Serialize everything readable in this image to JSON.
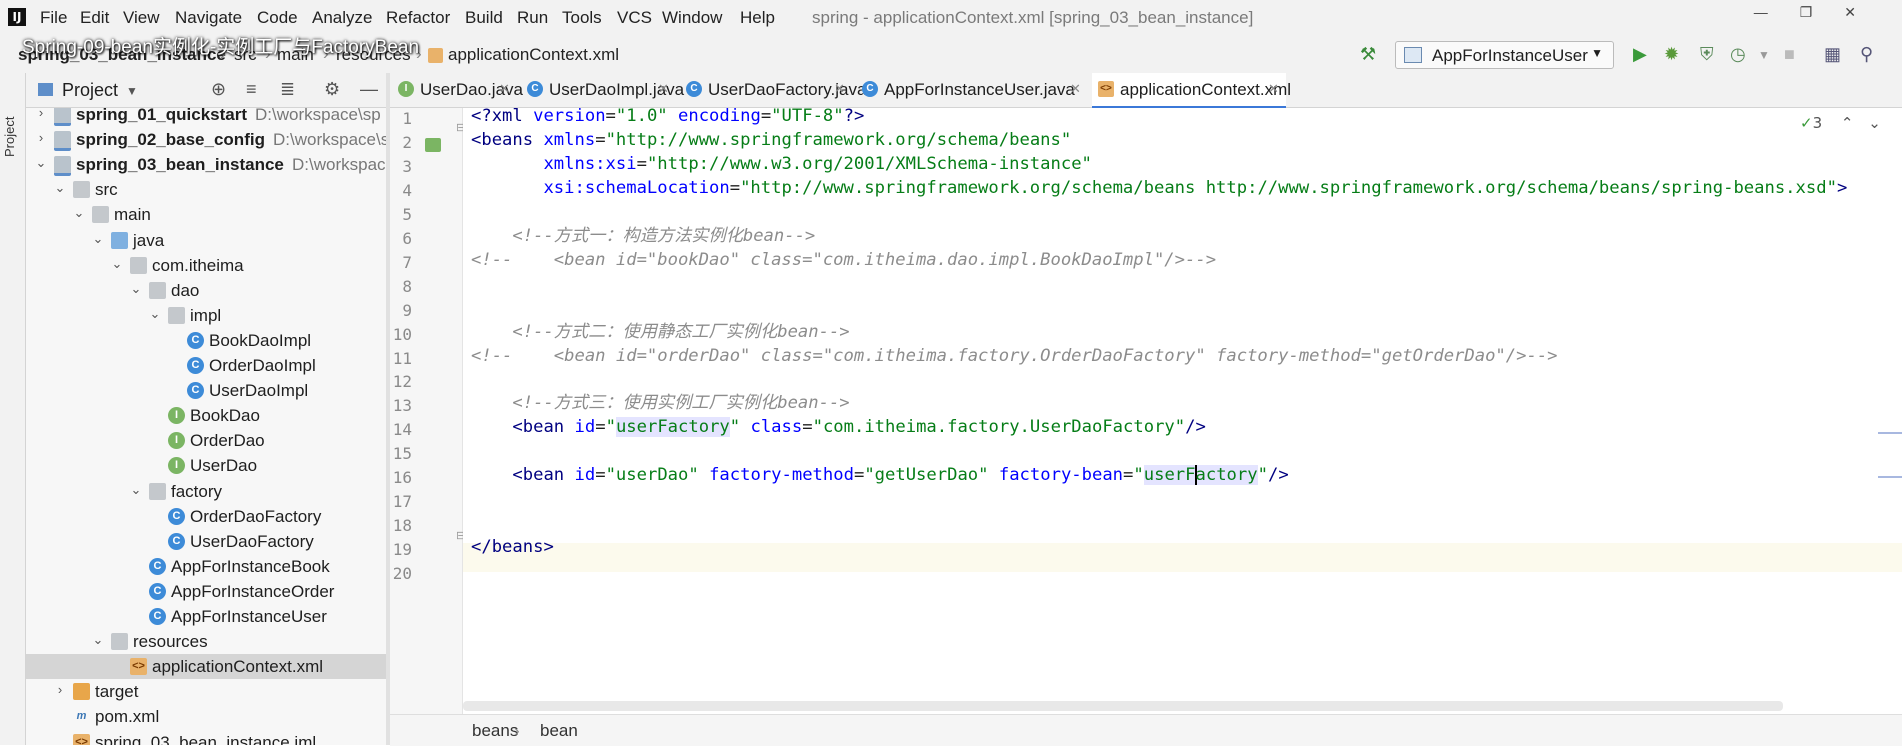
{
  "menu": {
    "items": [
      "File",
      "Edit",
      "View",
      "Navigate",
      "Code",
      "Analyze",
      "Refactor",
      "Build",
      "Run",
      "Tools",
      "VCS",
      "Window",
      "Help"
    ],
    "window_title": "spring - applicationContext.xml [spring_03_bean_instance]"
  },
  "overlay": {
    "title": "Spring-09-bean实例化-实例工厂与FactoryBean"
  },
  "navbar": {
    "breadcrumbs": [
      "spring_03_bean_instance",
      "src",
      "main",
      "resources",
      "applicationContext.xml"
    ],
    "run_config": "AppForInstanceUser"
  },
  "project": {
    "header": "Project",
    "side_label": "Project",
    "tree": [
      {
        "label": "spring_01_quickstart",
        "path": "D:\\workspace\\sp",
        "icon": "module",
        "arrow": "right",
        "bold": true
      },
      {
        "label": "spring_02_base_config",
        "path": "D:\\workspace\\s",
        "icon": "module",
        "arrow": "right",
        "bold": true
      },
      {
        "label": "spring_03_bean_instance",
        "path": "D:\\workspace",
        "icon": "module",
        "arrow": "down",
        "bold": true
      },
      {
        "label": "src",
        "icon": "folder",
        "arrow": "down"
      },
      {
        "label": "main",
        "icon": "folder",
        "arrow": "down"
      },
      {
        "label": "java",
        "icon": "folder-blue",
        "arrow": "down"
      },
      {
        "label": "com.itheima",
        "icon": "folder",
        "arrow": "down"
      },
      {
        "label": "dao",
        "icon": "folder",
        "arrow": "down"
      },
      {
        "label": "impl",
        "icon": "folder",
        "arrow": "down"
      },
      {
        "label": "BookDaoImpl",
        "icon": "class"
      },
      {
        "label": "OrderDaoImpl",
        "icon": "class"
      },
      {
        "label": "UserDaoImpl",
        "icon": "class"
      },
      {
        "label": "BookDao",
        "icon": "interface"
      },
      {
        "label": "OrderDao",
        "icon": "interface"
      },
      {
        "label": "UserDao",
        "icon": "interface"
      },
      {
        "label": "factory",
        "icon": "folder",
        "arrow": "down"
      },
      {
        "label": "OrderDaoFactory",
        "icon": "class"
      },
      {
        "label": "UserDaoFactory",
        "icon": "class"
      },
      {
        "label": "AppForInstanceBook",
        "icon": "runclass"
      },
      {
        "label": "AppForInstanceOrder",
        "icon": "runclass"
      },
      {
        "label": "AppForInstanceUser",
        "icon": "runclass"
      },
      {
        "label": "resources",
        "icon": "folder",
        "arrow": "down"
      },
      {
        "label": "applicationContext.xml",
        "icon": "xml",
        "selected": true
      },
      {
        "label": "target",
        "icon": "folder-orange",
        "arrow": "right"
      },
      {
        "label": "pom.xml",
        "icon": "maven"
      },
      {
        "label": "spring_03_bean_instance.iml",
        "icon": "xml"
      }
    ]
  },
  "tabs": [
    {
      "label": "UserDao.java",
      "icon": "interface"
    },
    {
      "label": "UserDaoImpl.java",
      "icon": "class"
    },
    {
      "label": "UserDaoFactory.java",
      "icon": "class"
    },
    {
      "label": "AppForInstanceUser.java",
      "icon": "runclass"
    },
    {
      "label": "applicationContext.xml",
      "icon": "xml",
      "active": true
    }
  ],
  "editor": {
    "line_numbers": [
      "1",
      "2",
      "3",
      "4",
      "5",
      "6",
      "7",
      "8",
      "9",
      "10",
      "11",
      "12",
      "13",
      "14",
      "15",
      "16",
      "17",
      "18",
      "19",
      "20"
    ],
    "inspection_count": "3",
    "lines": [
      "<?xml version=\"1.0\" encoding=\"UTF-8\"?>",
      "<beans xmlns=\"http://www.springframework.org/schema/beans\"",
      "       xmlns:xsi=\"http://www.w3.org/2001/XMLSchema-instance\"",
      "       xsi:schemaLocation=\"http://www.springframework.org/schema/beans http://www.springframework.org/schema/beans/spring-beans.xsd\">",
      "",
      "    <!--方式一：构造方法实例化bean-->",
      "<!--    <bean id=\"bookDao\" class=\"com.itheima.dao.impl.BookDaoImpl\"/>-->",
      "",
      "",
      "    <!--方式二：使用静态工厂实例化bean-->",
      "<!--    <bean id=\"orderDao\" class=\"com.itheima.factory.OrderDaoFactory\" factory-method=\"getOrderDao\"/>-->",
      "",
      "    <!--方式三：使用实例工厂实例化bean-->",
      "    <bean id=\"userFactory\" class=\"com.itheima.factory.UserDaoFactory\"/>",
      "",
      "    <bean id=\"userDao\" factory-method=\"getUserDao\" factory-bean=\"userFactory\"/>",
      "",
      "",
      "</beans>",
      ""
    ]
  },
  "bottom_breadcrumb": [
    "beans",
    "bean"
  ]
}
